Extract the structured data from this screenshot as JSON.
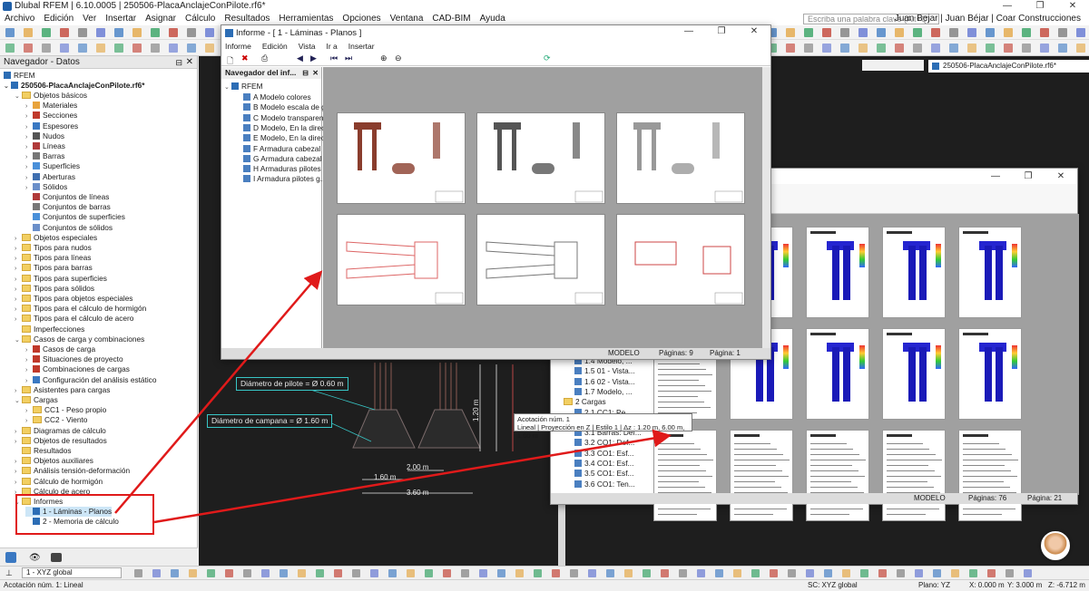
{
  "window": {
    "title": "Dlubal RFEM | 6.10.0005 | 250506-PlacaAnclajeConPilote.rf6*",
    "controls": [
      "—",
      "❐",
      "✕"
    ]
  },
  "menu": {
    "items": [
      "Archivo",
      "Edición",
      "Ver",
      "Insertar",
      "Asignar",
      "Cálculo",
      "Resultados",
      "Herramientas",
      "Opciones",
      "Ventana",
      "CAD-BIM",
      "Ayuda"
    ],
    "search_placeholder": "Escriba una palabra clave (Alt+Q)",
    "user": "Juan Bejar | Juan Béjar | Coar Construcciones"
  },
  "navigator": {
    "title": "Navegador - Datos",
    "root": "RFEM",
    "model": "250506-PlacaAnclajeConPilote.rf6*",
    "items": [
      {
        "label": "Objetos básicos",
        "level": 1,
        "type": "folder",
        "open": true
      },
      {
        "label": "Materiales",
        "level": 2,
        "type": "item",
        "color": "#e8a33c"
      },
      {
        "label": "Secciones",
        "level": 2,
        "type": "item",
        "color": "#c0392b"
      },
      {
        "label": "Espesores",
        "level": 2,
        "type": "item",
        "color": "#3a78c2"
      },
      {
        "label": "Nudos",
        "level": 2,
        "type": "item",
        "color": "#555555"
      },
      {
        "label": "Líneas",
        "level": 2,
        "type": "item",
        "color": "#b03a3a"
      },
      {
        "label": "Barras",
        "level": 2,
        "type": "item",
        "color": "#777777"
      },
      {
        "label": "Superficies",
        "level": 2,
        "type": "item",
        "color": "#4a90d9"
      },
      {
        "label": "Aberturas",
        "level": 2,
        "type": "item",
        "color": "#3f6fb0"
      },
      {
        "label": "Sólidos",
        "level": 2,
        "type": "item",
        "color": "#6b8fc9"
      },
      {
        "label": "Conjuntos de líneas",
        "level": 2,
        "type": "leaf",
        "color": "#b03a3a"
      },
      {
        "label": "Conjuntos de barras",
        "level": 2,
        "type": "leaf",
        "color": "#777777"
      },
      {
        "label": "Conjuntos de superficies",
        "level": 2,
        "type": "leaf",
        "color": "#4a90d9"
      },
      {
        "label": "Conjuntos de sólidos",
        "level": 2,
        "type": "leaf",
        "color": "#6b8fc9"
      },
      {
        "label": "Objetos especiales",
        "level": 1,
        "type": "folder"
      },
      {
        "label": "Tipos para nudos",
        "level": 1,
        "type": "folder"
      },
      {
        "label": "Tipos para líneas",
        "level": 1,
        "type": "folder"
      },
      {
        "label": "Tipos para barras",
        "level": 1,
        "type": "folder"
      },
      {
        "label": "Tipos para superficies",
        "level": 1,
        "type": "folder"
      },
      {
        "label": "Tipos para sólidos",
        "level": 1,
        "type": "folder"
      },
      {
        "label": "Tipos para objetos especiales",
        "level": 1,
        "type": "folder"
      },
      {
        "label": "Tipos para el cálculo de hormigón",
        "level": 1,
        "type": "folder"
      },
      {
        "label": "Tipos para el cálculo de acero",
        "level": 1,
        "type": "folder"
      },
      {
        "label": "Imperfecciones",
        "level": 1,
        "type": "folder-leaf"
      },
      {
        "label": "Casos de carga y combinaciones",
        "level": 1,
        "type": "folder",
        "open": true
      },
      {
        "label": "Casos de carga",
        "level": 2,
        "type": "item",
        "color": "#c0392b"
      },
      {
        "label": "Situaciones de proyecto",
        "level": 2,
        "type": "item",
        "color": "#c0392b"
      },
      {
        "label": "Combinaciones de cargas",
        "level": 2,
        "type": "item",
        "color": "#c0392b"
      },
      {
        "label": "Configuración del análisis estático",
        "level": 2,
        "type": "item",
        "color": "#3a78c2"
      },
      {
        "label": "Asistentes para cargas",
        "level": 1,
        "type": "folder"
      },
      {
        "label": "Cargas",
        "level": 1,
        "type": "folder",
        "open": true
      },
      {
        "label": "CC1 - Peso propio",
        "level": 2,
        "type": "folder"
      },
      {
        "label": "CC2 - Viento",
        "level": 2,
        "type": "folder"
      },
      {
        "label": "Diagramas de cálculo",
        "level": 1,
        "type": "folder"
      },
      {
        "label": "Objetos de resultados",
        "level": 1,
        "type": "folder"
      },
      {
        "label": "Resultados",
        "level": 1,
        "type": "folder-leaf"
      },
      {
        "label": "Objetos auxiliares",
        "level": 1,
        "type": "folder"
      },
      {
        "label": "Análisis tensión-deformación",
        "level": 1,
        "type": "folder"
      },
      {
        "label": "Cálculo de hormigón",
        "level": 1,
        "type": "folder"
      },
      {
        "label": "Cálculo de acero",
        "level": 1,
        "type": "folder"
      },
      {
        "label": "Informes",
        "level": 1,
        "type": "folder",
        "open": true
      },
      {
        "label": "1 - Láminas - Planos",
        "level": 2,
        "type": "report",
        "selected": true
      },
      {
        "label": "2 - Memoria de cálculo",
        "level": 2,
        "type": "report"
      }
    ]
  },
  "report1": {
    "title": "Informe - [ 1 - Láminas - Planos ]",
    "menu": [
      "Informe",
      "Edición",
      "Vista",
      "Ir a",
      "Insertar"
    ],
    "nav_title": "Navegador del inf...",
    "nav_root": "RFEM",
    "nav_items": [
      "A Modelo colores",
      "B Modelo escala de g...",
      "C Modelo transparen...",
      "D Modelo, En la direc...",
      "E Modelo, En la direc...",
      "F Armadura cabezal",
      "G Armadura cabezal ...",
      "H Armaduras pilotes",
      "I Armadura pilotes g..."
    ],
    "status": {
      "mode": "MODELO",
      "pages": "Páginas: 9",
      "page": "Página: 1"
    }
  },
  "report2": {
    "nav_items": [
      "1.4 Modelo, ...",
      "1.5 01 - Vista...",
      "1.6 02 - Vista...",
      "1.7 Modelo, ...",
      "2 Cargas",
      "2.1 CC1: Pe...",
      "3 Resultados del ...",
      "3.1 Barras: Def...",
      "3.2 CO1: Def...",
      "3.3 CO1: Esf...",
      "3.4 CO1: Esf...",
      "3.5 CO1: Esf...",
      "3.6 CO1: Ten..."
    ],
    "status": {
      "mode": "MODELO",
      "pages": "Páginas: 76",
      "page": "Página: 21"
    }
  },
  "drawing": {
    "ann_pilote": "Diámetro de pilote = Ø 0.60 m",
    "ann_campana": "Diámetro de campana = Ø 1.60 m",
    "dim_200": "2.00 m",
    "dim_160": "1.60 m",
    "dim_360": "3.60 m",
    "dim_120": "1.20 m",
    "model_tab": "250506-PlacaAnclajeConPilote.rf6*"
  },
  "tooltip": {
    "line1": "Acotación núm. 1",
    "line2": "Lineal | Proyección en Z | Estilo 1 | Δz : 1.20 m, 6.00 m, 1.00 m"
  },
  "bottom": {
    "coord_system": "1 - XYZ global"
  },
  "status": {
    "left": "Acotación núm. 1: Lineal",
    "sc": "SC: XYZ global",
    "plane": "Plano: YZ",
    "x": "X: 0.000 m",
    "y": "Y: 3.000 m",
    "z": "Z: -6.712 m"
  },
  "colors": {
    "accent": "#e01a1a",
    "cyan": "#38c6c6",
    "selection": "#cde6f7"
  }
}
